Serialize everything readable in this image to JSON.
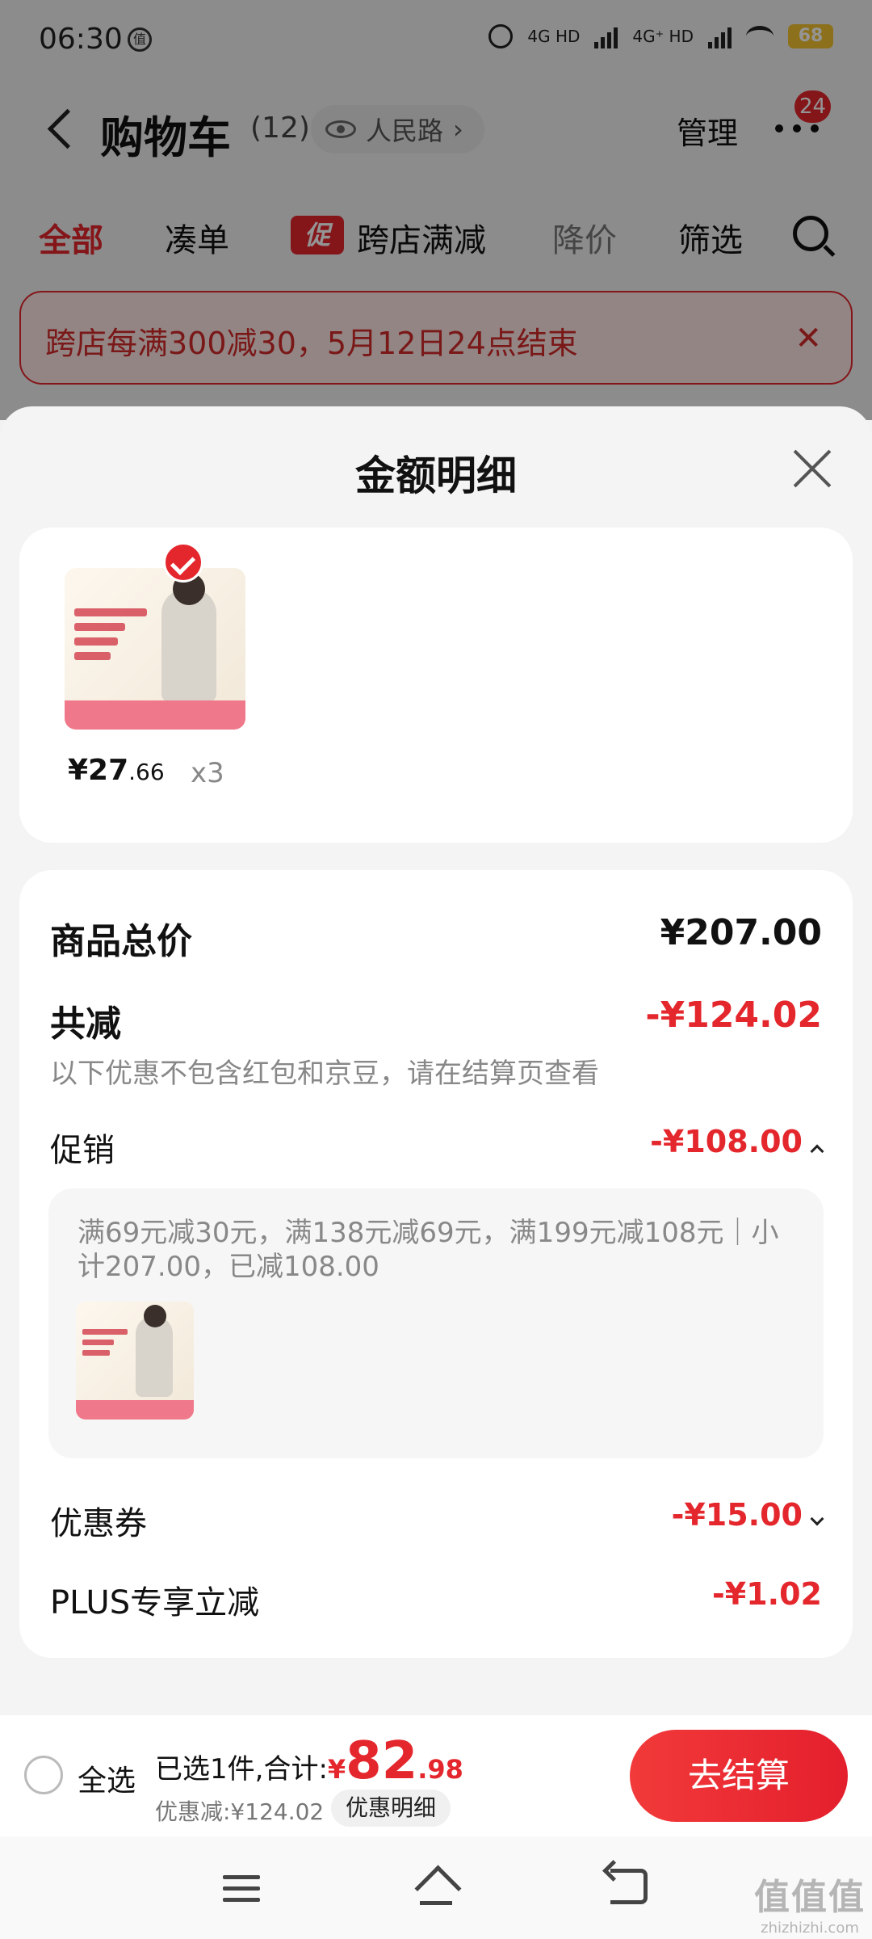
{
  "status_bar": {
    "time": "06:30",
    "notif_icon": "值",
    "net1": "4G HD",
    "net2": "4G⁺ HD",
    "battery": "68"
  },
  "header": {
    "title": "购物车",
    "count": "(12)",
    "location": "人民路",
    "manage": "管理",
    "badge": "24"
  },
  "tabs": {
    "all": "全部",
    "bundle": "凑单",
    "promo_tag": "促",
    "cross_store": "跨店满减",
    "price_drop": "降价",
    "filter": "筛选"
  },
  "banner": {
    "text": "跨店每满300减30，5月12日24点结束",
    "close": "✕"
  },
  "sheet": {
    "title": "金额明细",
    "product": {
      "price_main": "¥27",
      "price_cents": ".66",
      "qty": "x3"
    },
    "total_label": "商品总价",
    "total_value": "¥207.00",
    "reduce_label": "共减",
    "reduce_value": "-¥124.02",
    "reduce_note": "以下优惠不包含红包和京豆，请在结算页查看",
    "promo_label": "促销",
    "promo_value": "-¥108.00",
    "promo_detail": "满69元减30元，满138元减69元，满199元减108元｜小计207.00，已减108.00",
    "coupon_label": "优惠券",
    "coupon_value": "-¥15.00",
    "plus_label": "PLUS专享立减",
    "plus_value": "-¥1.02"
  },
  "checkout": {
    "select_all": "全选",
    "selected_text": "已选1件,合计:",
    "currency": "¥",
    "total_main": "82",
    "total_cents": ".98",
    "discount_text": "优惠减:¥124.02",
    "detail_chip": "优惠明细",
    "button": "去结算"
  },
  "watermark": {
    "main": "值值值",
    "sub": "zhizhizhi.com"
  },
  "colors": {
    "accent": "#e4272d"
  }
}
